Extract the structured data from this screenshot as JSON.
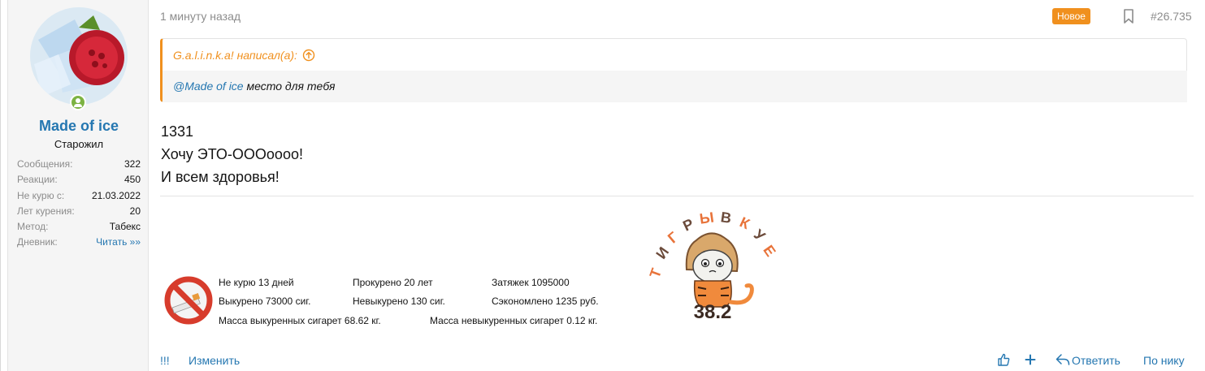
{
  "user": {
    "name": "Made of ice",
    "title": "Старожил",
    "stats": [
      {
        "label": "Сообщения:",
        "value": "322"
      },
      {
        "label": "Реакции:",
        "value": "450"
      },
      {
        "label": "Не курю с:",
        "value": "21.03.2022"
      },
      {
        "label": "Лет курения:",
        "value": "20"
      },
      {
        "label": "Метод:",
        "value": "Табекс"
      },
      {
        "label": "Дневник:",
        "value": "Читать »»"
      }
    ]
  },
  "post": {
    "time": "1 минуту назад",
    "badge": "Новое",
    "number": "#26.735",
    "quote": {
      "author_line": "G.a.l.i.n.k.a! написал(а):",
      "mention": "@Made of ice",
      "text": " место для тебя"
    },
    "message_lines": [
      "1331",
      "Хочу ЭТО-ОООoooo!",
      "И всем здоровья!"
    ]
  },
  "signature": {
    "quitter": {
      "row1": [
        "Не курю 13 дней",
        "Прокурено 20 лет",
        "Затяжек 1095000"
      ],
      "row2": [
        "Выкурено 73000 сиг.",
        "Невыкурено 130 сиг.",
        "Сэкономлено 1235 руб."
      ],
      "row3": [
        "Масса выкуренных сигарет 68.62 кг.",
        "Масса невыкуренных сигарет 0.12 кг."
      ]
    },
    "tiger": {
      "banner_text": "ТИГРЫ В КУЕ",
      "number": "38.2"
    }
  },
  "actions": {
    "report": "!!!",
    "edit": "Изменить",
    "reply": "Ответить",
    "by_nick": "По нику"
  },
  "colors": {
    "accent": "#2577b1",
    "orange": "#f0901e",
    "online": "#7cb342"
  }
}
